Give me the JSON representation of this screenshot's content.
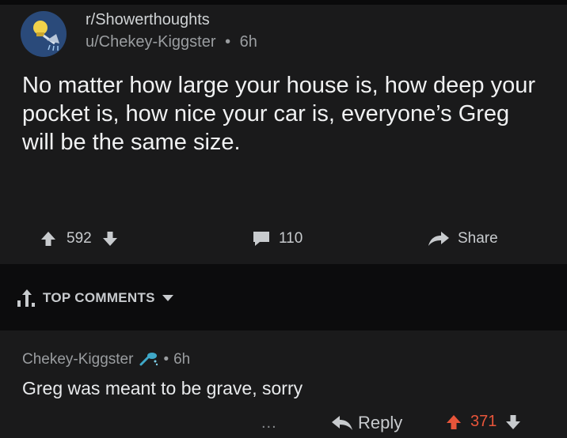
{
  "post": {
    "subreddit": "r/Showerthoughts",
    "author": "u/Chekey-Kiggster",
    "separator": "•",
    "age": "6h",
    "title": "No matter how large your house is, how deep your pocket is, how nice your car is, everyone’s Greg will be the same size.",
    "score": "592",
    "comment_count": "110",
    "share_label": "Share"
  },
  "comments_section": {
    "sort_label": "TOP COMMENTS"
  },
  "comment": {
    "author": "Chekey-Kiggster",
    "separator": "•",
    "age": "6h",
    "body": "Greg was meant to be grave, sorry",
    "more": "...",
    "reply_label": "Reply",
    "score": "371"
  },
  "colors": {
    "background": "#1a1a1b",
    "upvoted": "#e8553a",
    "avatar": "#2a4a7a",
    "flair_icon": "#3fa8c8"
  },
  "icons": [
    "showerhead-icon",
    "upvote-icon",
    "downvote-icon",
    "comment-icon",
    "share-icon",
    "sort-icon",
    "chevron-down-icon",
    "flair-icon",
    "reply-icon"
  ]
}
